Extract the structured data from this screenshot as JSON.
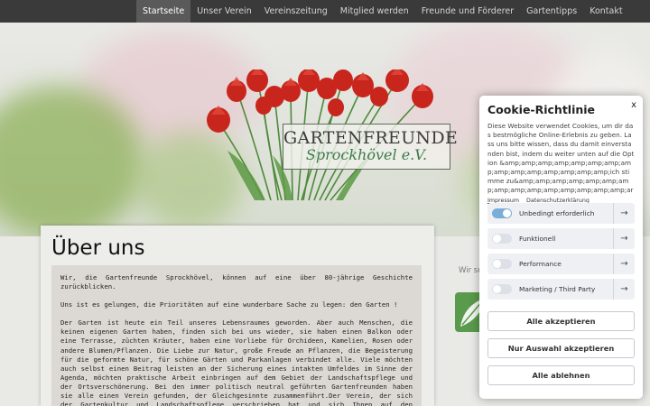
{
  "nav": {
    "items": [
      {
        "label": "Startseite",
        "active": true
      },
      {
        "label": "Unser Verein",
        "active": false
      },
      {
        "label": "Vereinszeitung",
        "active": false
      },
      {
        "label": "Mitglied werden",
        "active": false
      },
      {
        "label": "Freunde und Förderer",
        "active": false
      },
      {
        "label": "Gartentipps",
        "active": false
      },
      {
        "label": "Kontakt",
        "active": false
      }
    ]
  },
  "logo": {
    "line1": "GARTENFREUNDE",
    "line2": "Sprockhövel e.V."
  },
  "main": {
    "title": "Über uns",
    "paragraphs": [
      "Wir, die Gartenfreunde Sprockhövel, können auf eine über 80-jährige Geschichte zurückblicken.",
      "Uns ist es gelungen, die Prioritäten auf eine wunderbare Sache zu legen: den Garten !",
      "Der Garten ist heute ein Teil unseres Lebensraumes geworden. Aber auch Menschen, die keinen eigenen Garten haben, finden sich bei uns wieder, sie haben einen Balkon oder eine Terrasse, züchten Kräuter, haben eine Vorliebe für Orchideen, Kamelien, Rosen oder andere Blumen/Pflanzen. Die Liebe zur Natur, große Freude an Pflanzen, die Begeisterung für die geformte Natur, für schöne Gärten und Parkanlagen verbindet alle. Viele möchten auch selbst einen Beitrag leisten an der Sicherung eines intakten Umfeldes im Sinne der Agenda, möchten praktische Arbeit einbringen auf dem Gebiet der Landschaftspflege und der Ortsverschönerung. Bei den immer politisch neutral geführten Gartenfreunden haben sie alle einen Verein gefunden, der Gleichgesinnte zusammenführt.Der Verein, der sich der Gartenkultur und Landschaftspflege verschrieben hat und sich Ihnen auf den nachfolgenden"
    ]
  },
  "sidebar": {
    "partial_text": "Wir su"
  },
  "cookie": {
    "title": "Cookie-Richtlinie",
    "close_label": "x",
    "body": "Diese Website verwendet Cookies, um dir das bestmögliche Online-Erlebnis zu geben. Lass uns bitte wissen, dass du damit einverstanden bist, indem du weiter unten auf die Option &amp;amp;amp;amp;amp;amp;amp;amp;amp;amp;amp;amp;amp;amp;amp;ich stimme zu&amp;amp;amp;amp;amp;amp;amp;amp;amp;amp;amp;amp;amp;amp;amp;ar",
    "links": [
      "Impressum",
      "Datenschutzerklärung"
    ],
    "options": [
      {
        "label": "Unbedingt erforderlich",
        "enabled": true
      },
      {
        "label": "Funktionell",
        "enabled": false
      },
      {
        "label": "Performance",
        "enabled": false
      },
      {
        "label": "Marketing / Third Party",
        "enabled": false
      }
    ],
    "buttons": {
      "accept_all": "Alle akzeptieren",
      "accept_selection": "Nur Auswahl akzeptieren",
      "reject_all": "Alle ablehnen"
    },
    "arrow_glyph": "→"
  },
  "colors": {
    "nav_bg": "#3a3a3a",
    "nav_active": "#5a5a5a",
    "tulip_red": "#c8261c",
    "toggle_on": "#7aaed9",
    "brand_green": "#3d7a4a"
  }
}
